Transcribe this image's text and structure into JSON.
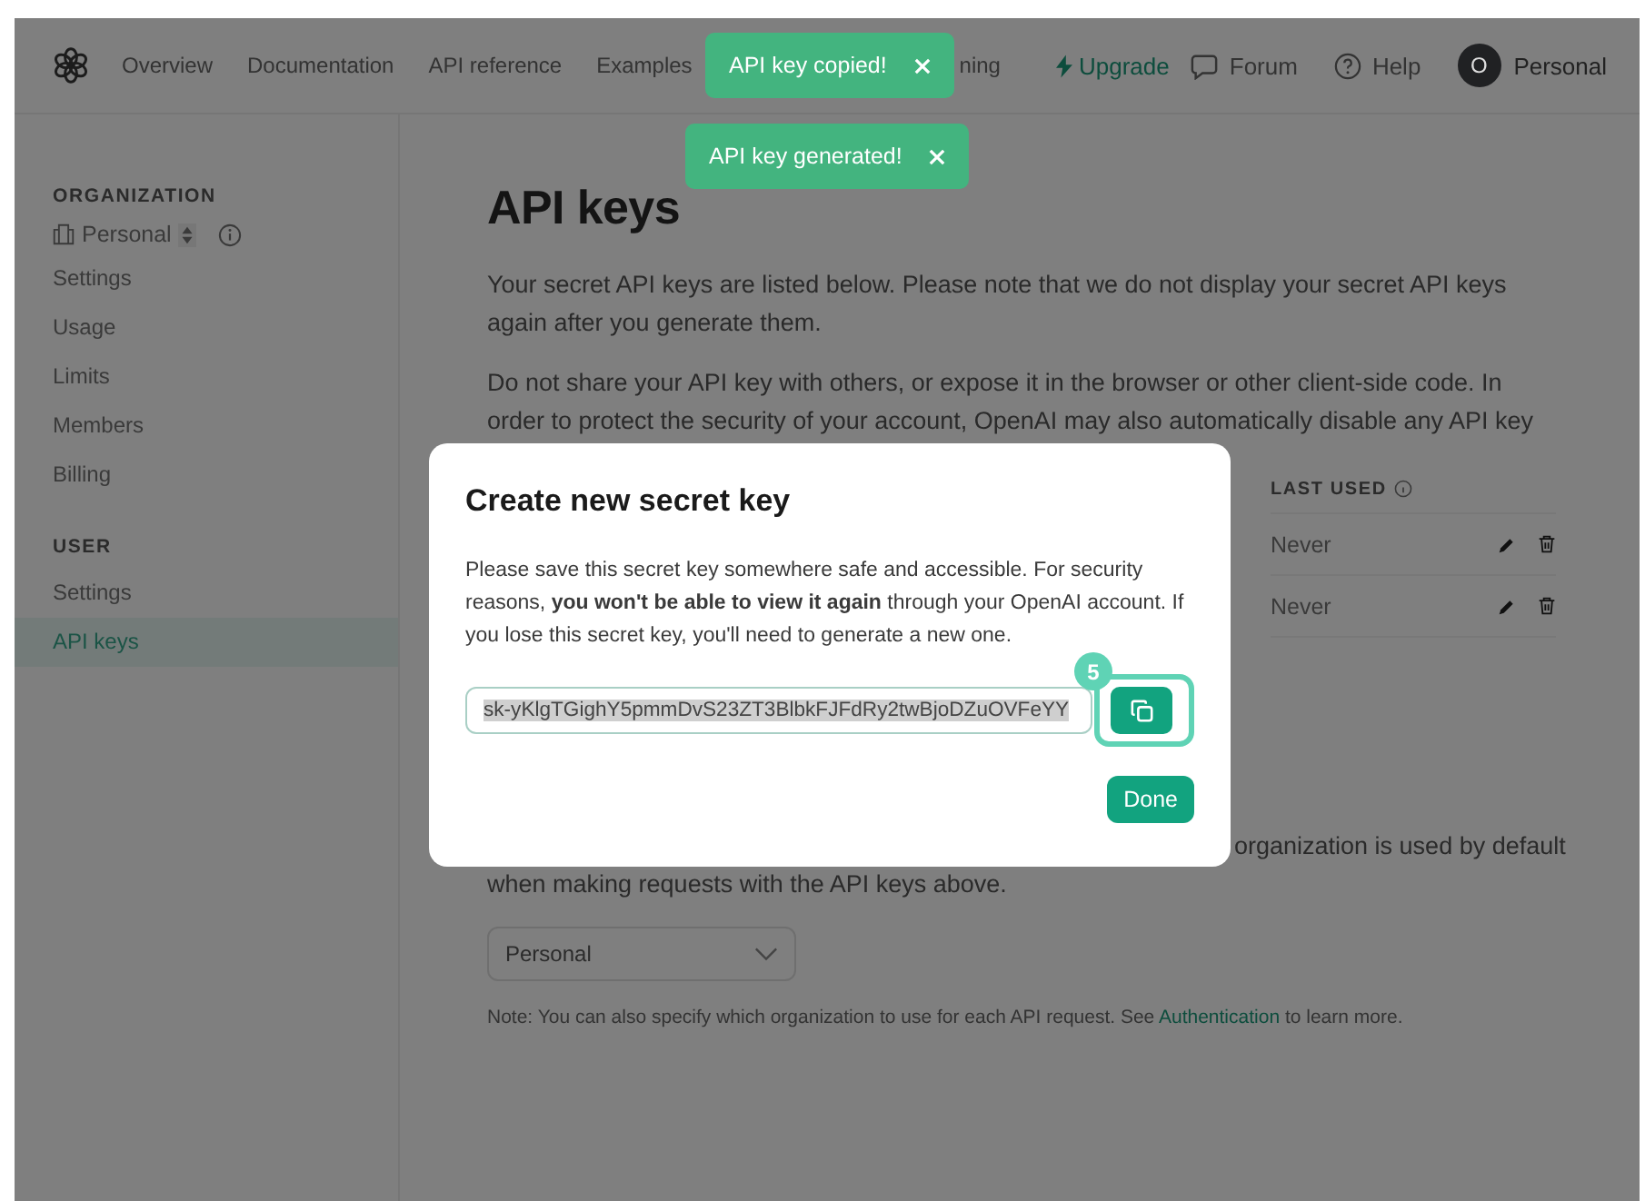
{
  "toasts": [
    {
      "text": "API key copied!"
    },
    {
      "text": "API key generated!"
    }
  ],
  "nav": {
    "links": [
      "Overview",
      "Documentation",
      "API reference",
      "Examples",
      "ning"
    ],
    "upgrade": "Upgrade",
    "forum": "Forum",
    "help": "Help",
    "avatar": "O",
    "account": "Personal"
  },
  "sidebar": {
    "sections": [
      {
        "heading": "ORGANIZATION",
        "org": "Personal",
        "items": [
          {
            "label": "Settings",
            "selected": false
          },
          {
            "label": "Usage",
            "selected": false
          },
          {
            "label": "Limits",
            "selected": false
          },
          {
            "label": "Members",
            "selected": false
          },
          {
            "label": "Billing",
            "selected": false
          }
        ]
      },
      {
        "heading": "USER",
        "items": [
          {
            "label": "Settings",
            "selected": false
          },
          {
            "label": "API keys",
            "selected": true
          }
        ]
      }
    ]
  },
  "page": {
    "title": "API keys",
    "paragraphs": [
      "Your secret API keys are listed below. Please note that we do not display your secret API keys again after you generate them.",
      "Do not share your API key with others, or expose it in the browser or other client-side code. In order to protect the security of your account, OpenAI may also automatically disable any API key"
    ],
    "table": {
      "columns": [
        "LAST USED"
      ],
      "rows": [
        {
          "last_used": "Never"
        },
        {
          "last_used": "Never"
        }
      ]
    },
    "default_org_lines": [
      "organization is used by default",
      "when making requests with the API keys above."
    ],
    "org_select": "Personal",
    "note": {
      "before": "Note: You can also specify which organization to use for each API request. See ",
      "link": "Authentication",
      "after": " to learn more."
    }
  },
  "modal": {
    "title": "Create new secret key",
    "body": "Please save this secret key somewhere safe and accessible. For security reasons, **you won't be able to view it again** through your OpenAI account. If you lose this secret key, you'll need to generate a new one.",
    "key": "sk-yKlgTGighY5pmmDvS23ZT3BlbkFJFdRy2twBjoDZuOVFeYY",
    "step": "5",
    "done": "Done"
  }
}
